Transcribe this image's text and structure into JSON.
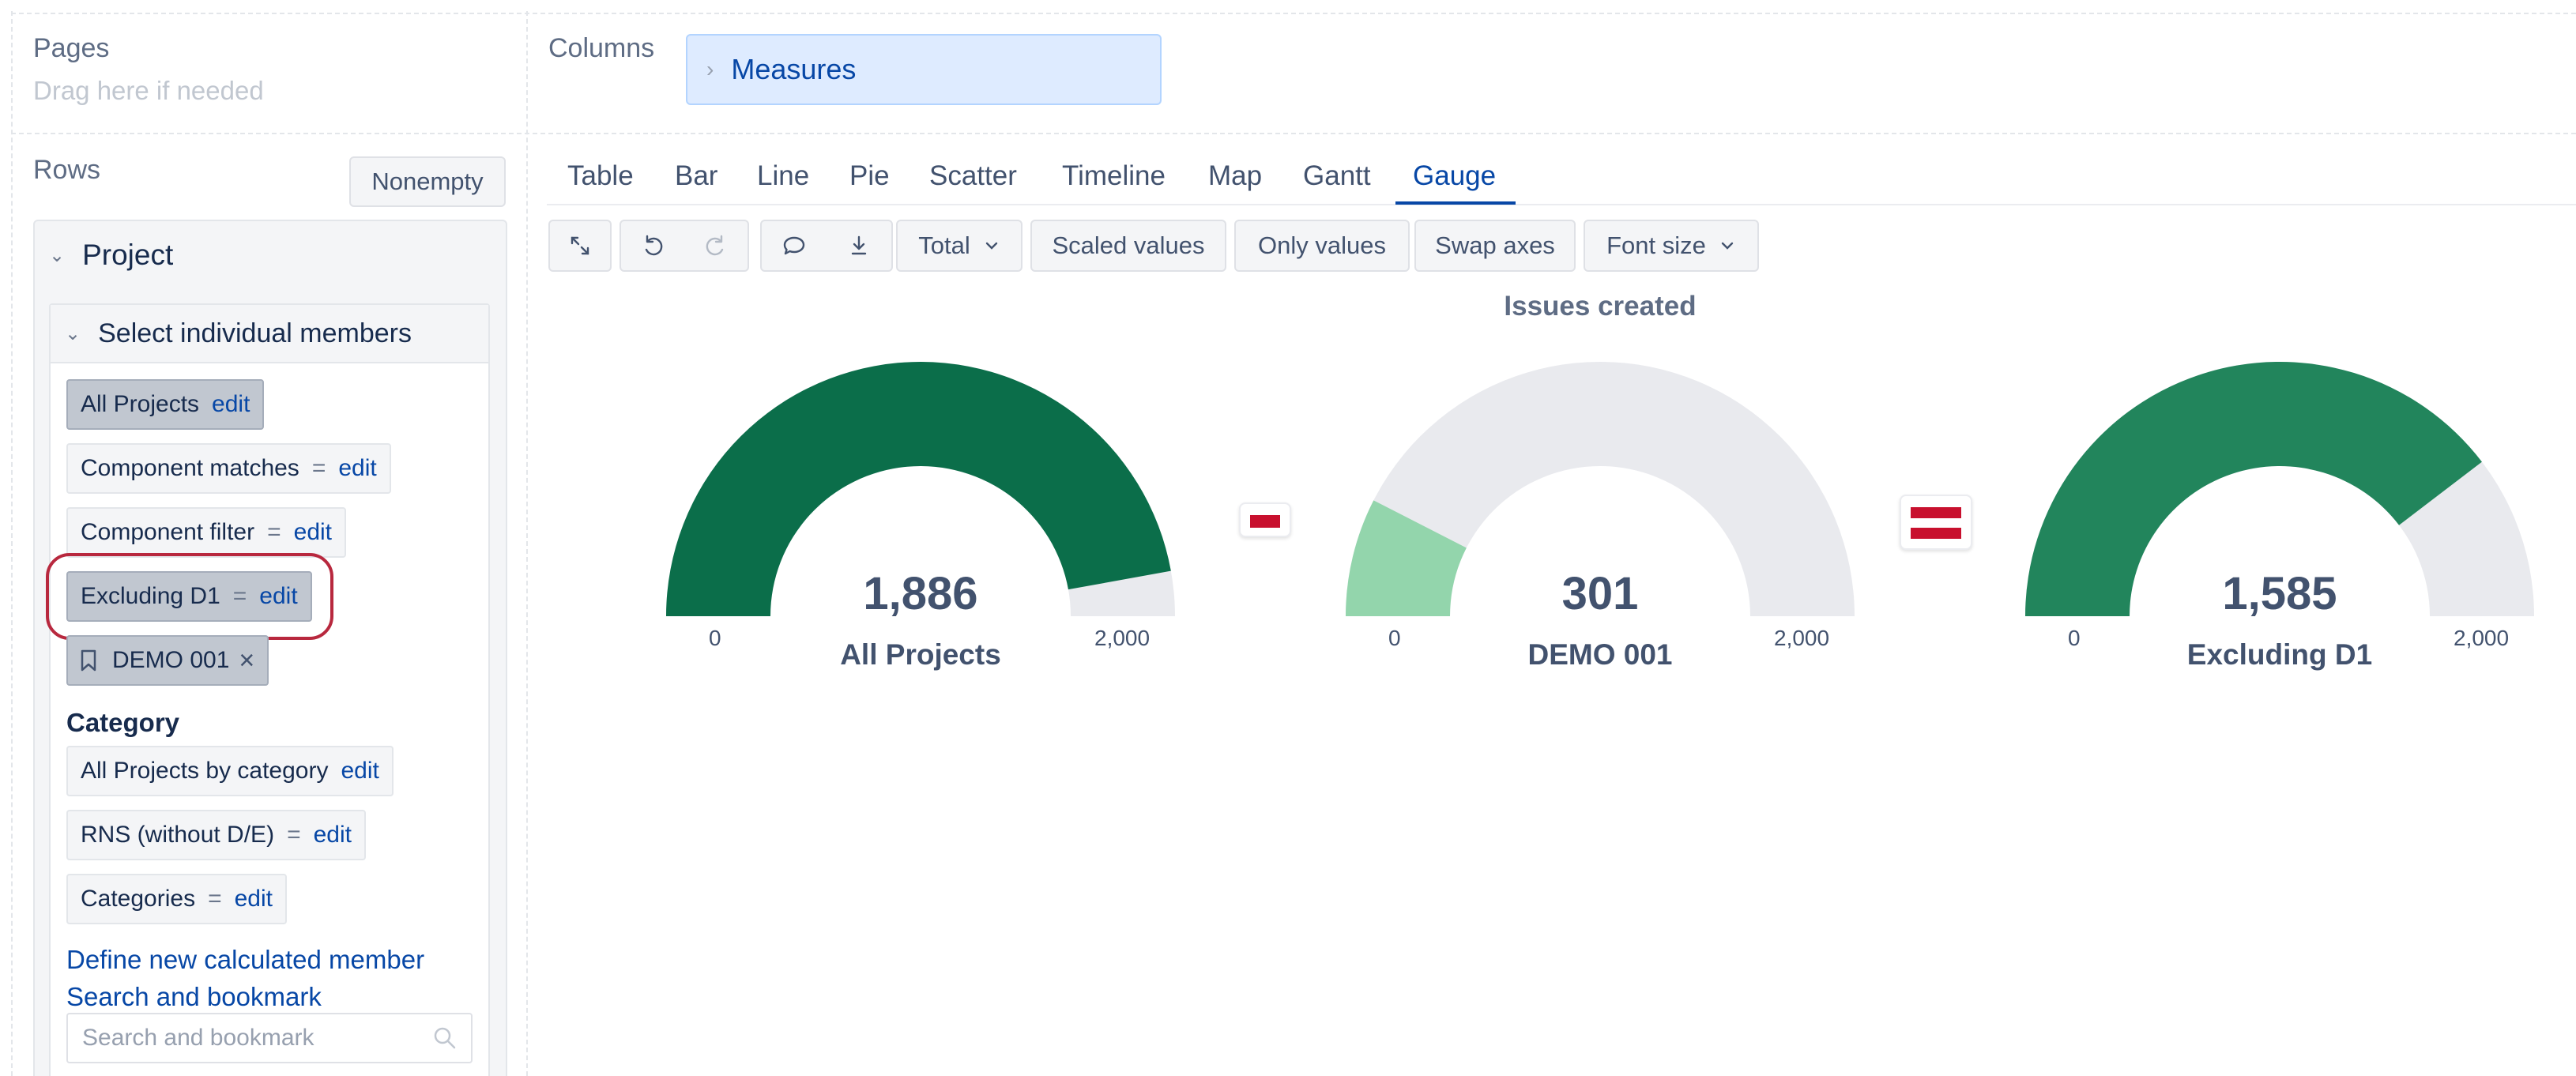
{
  "pages": {
    "title": "Pages",
    "hint": "Drag here if needed"
  },
  "columns": {
    "title": "Columns",
    "chip": "Measures"
  },
  "rows": {
    "title": "Rows",
    "nonempty_label": "Nonempty",
    "dimension": "Project",
    "section": "Select individual members",
    "members": [
      {
        "label": "All Projects",
        "edit": "edit",
        "selected": true
      },
      {
        "label": "Component matches",
        "eq": "=",
        "edit": "edit"
      },
      {
        "label": "Component filter",
        "eq": "=",
        "edit": "edit"
      },
      {
        "label": "Excluding D1",
        "eq": "=",
        "edit": "edit",
        "selected": true
      },
      {
        "label": "DEMO 001",
        "close": "×",
        "selected": true
      }
    ],
    "category_title": "Category",
    "category_members": [
      {
        "label": "All Projects by category",
        "edit": "edit"
      },
      {
        "label": "RNS (without D/E)",
        "eq": "=",
        "edit": "edit"
      },
      {
        "label": "Categories",
        "eq": "=",
        "edit": "edit"
      }
    ],
    "define_link": "Define new calculated member",
    "search_link": "Search and bookmark",
    "search_placeholder": "Search and bookmark"
  },
  "tabs": [
    "Table",
    "Bar",
    "Line",
    "Pie",
    "Scatter",
    "Timeline",
    "Map",
    "Gantt",
    "Gauge"
  ],
  "active_tab": "Gauge",
  "toolbar": {
    "total": "Total",
    "scaled": "Scaled values",
    "only": "Only values",
    "swap": "Swap axes",
    "font": "Font size"
  },
  "chart_data": {
    "type": "gauge",
    "title": "Issues created",
    "min": 0,
    "max": 2000,
    "min_label": "0",
    "max_label": "2,000",
    "series": [
      {
        "name": "All Projects",
        "value": 1886,
        "label": "1,886",
        "color": "#0b6e4a"
      },
      {
        "name": "DEMO 001",
        "value": 301,
        "label": "301",
        "color": "#93d5ac"
      },
      {
        "name": "Excluding D1",
        "value": 1585,
        "label": "1,585",
        "color": "#22855c"
      }
    ],
    "operators": [
      "minus",
      "equals"
    ],
    "track_color": "#e9eaee",
    "operator_color": "#c8102e"
  }
}
